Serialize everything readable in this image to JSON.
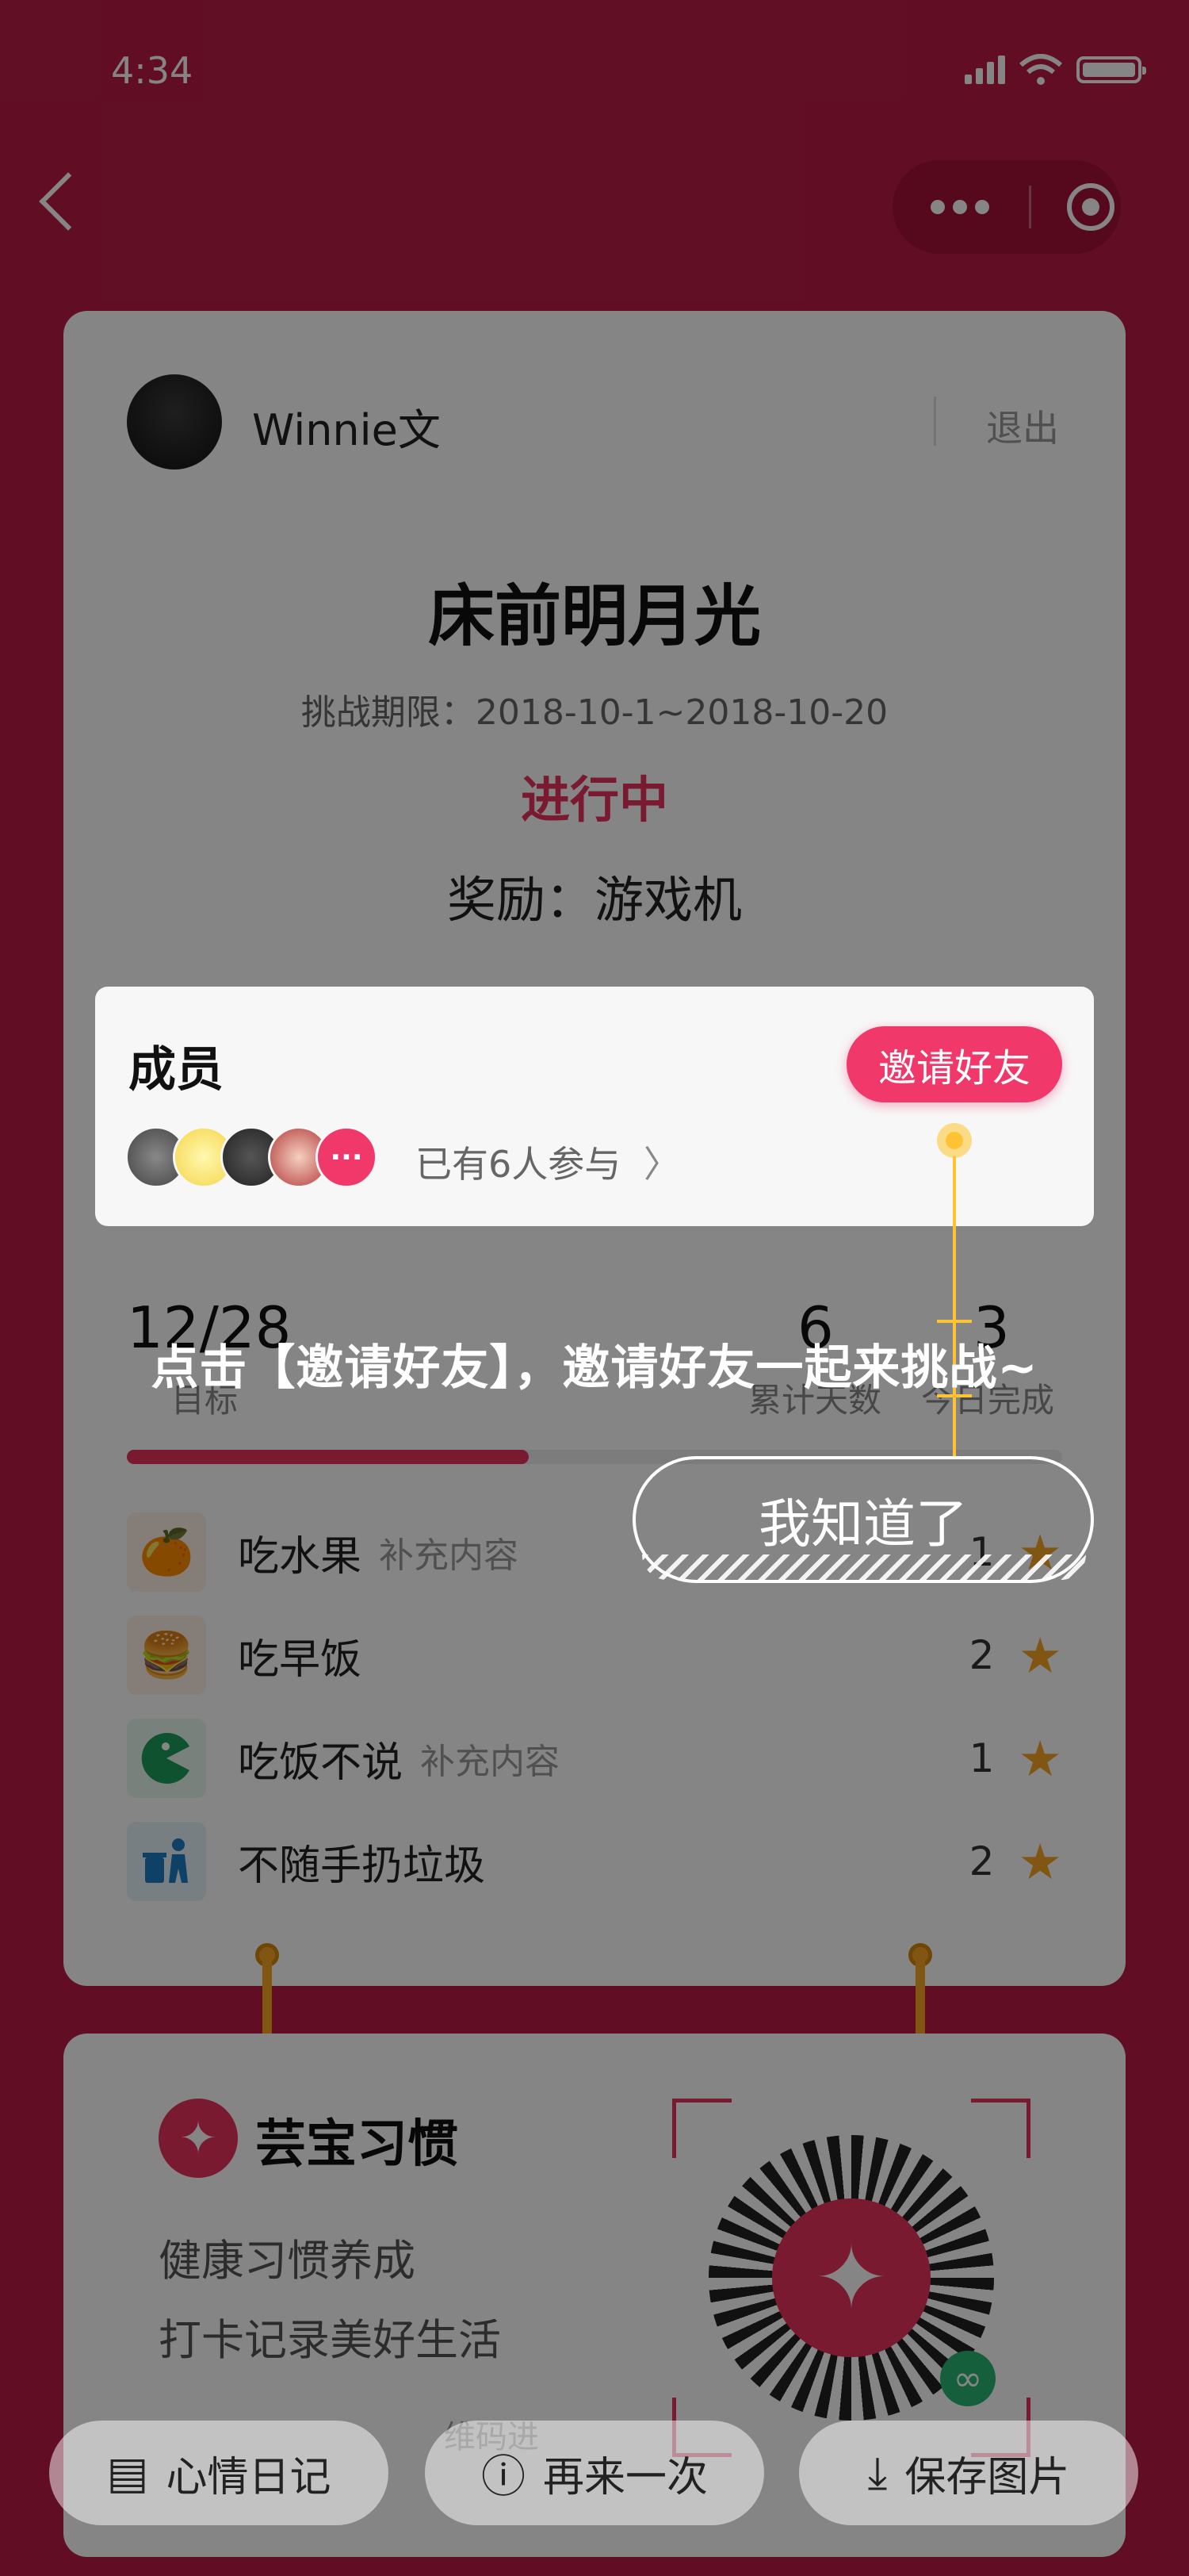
{
  "status_bar": {
    "time": "4:34"
  },
  "profile": {
    "username": "Winnie文",
    "exit_label": "退出"
  },
  "challenge": {
    "title": "床前明月光",
    "period": "挑战期限：2018-10-1~2018-10-20",
    "status": "进行中",
    "reward": "奖励：游戏机"
  },
  "members": {
    "title": "成员",
    "invite_label": "邀请好友",
    "joined_text": "已有6人参与",
    "more_label": "···"
  },
  "stats": {
    "progress_value": "12/28",
    "progress_label": "目标",
    "days_value": "6",
    "days_label": "累计天数",
    "today_value": "3",
    "today_label": "今日完成",
    "progress_fraction": 0.43
  },
  "habits": [
    {
      "name": "吃水果",
      "note": "补充内容",
      "count": "1",
      "icon": "orange-icon"
    },
    {
      "name": "吃早饭",
      "note": "",
      "count": "2",
      "icon": "burger-icon"
    },
    {
      "name": "吃饭不说",
      "note": "补充内容",
      "count": "1",
      "icon": "pacman-icon"
    },
    {
      "name": "不随手扔垃圾",
      "note": "",
      "count": "2",
      "icon": "trash-icon"
    }
  ],
  "brand": {
    "name": "芸宝习惯",
    "slogan1": "健康习惯养成",
    "slogan2": "打卡记录美好生活",
    "qr_hint": "维码进"
  },
  "guide": {
    "tip": "点击【邀请好友】，邀请好友一起来挑战~",
    "ok_label": "我知道了"
  },
  "bottom_bar": {
    "mood_label": "心情日记",
    "retry_label": "再来一次",
    "save_label": "保存图片"
  },
  "colors": {
    "background": "#ba1c45",
    "accent": "#f0386a",
    "star": "#f5a623",
    "guide": "#ffc233"
  }
}
